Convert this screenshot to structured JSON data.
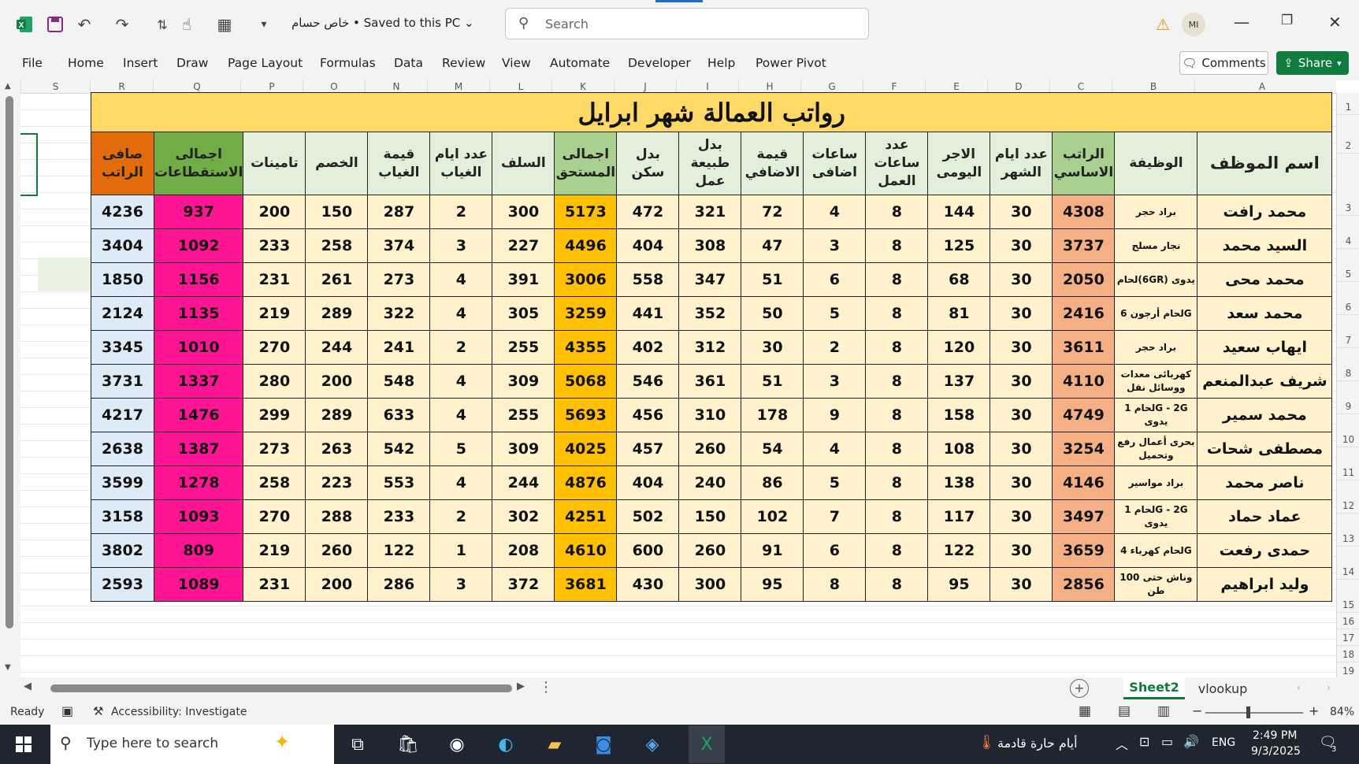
{
  "titlebar": {
    "doc_title": "خاص حسام • Saved to this PC ⌄",
    "search_placeholder": "Search",
    "avatar": "MI",
    "warning_icon": "warning-icon"
  },
  "ribbon": {
    "tabs": [
      "File",
      "Home",
      "Insert",
      "Draw",
      "Page Layout",
      "Formulas",
      "Data",
      "Review",
      "View",
      "Automate",
      "Developer",
      "Help",
      "Power Pivot"
    ],
    "comments": "Comments",
    "share": "Share"
  },
  "columns": [
    "S",
    "R",
    "Q",
    "P",
    "O",
    "N",
    "M",
    "L",
    "K",
    "J",
    "I",
    "H",
    "G",
    "F",
    "E",
    "D",
    "C",
    "B",
    "A"
  ],
  "rows": [
    "1",
    "2",
    "3",
    "4",
    "5",
    "6",
    "7",
    "8",
    "9",
    "10",
    "11",
    "12",
    "13",
    "14",
    "15",
    "16",
    "17",
    "18",
    "19"
  ],
  "sheet": {
    "title": "رواتب العمالة شهر ابرايل",
    "headers": [
      "صافى الراتب",
      "اجمالى الاستقطاعات",
      "تامينات",
      "الخصم",
      "قيمة الغياب",
      "عدد ايام الغياب",
      "السلف",
      "اجمالى المستحق",
      "بدل سكن",
      "بدل طبيعة عمل",
      "قيمة الاضافي",
      "ساعات اضافى",
      "عدد ساعات العمل",
      "الاجر اليومى",
      "عدد ايام الشهر",
      "الراتب الاساسي",
      "الوظيفة",
      "اسم الموظف"
    ],
    "rows": [
      [
        "4236",
        "937",
        "200",
        "150",
        "287",
        "2",
        "300",
        "5173",
        "472",
        "321",
        "72",
        "4",
        "8",
        "144",
        "30",
        "4308",
        "براد حجر",
        "محمد رافت"
      ],
      [
        "3404",
        "1092",
        "233",
        "258",
        "374",
        "3",
        "227",
        "4496",
        "404",
        "308",
        "47",
        "3",
        "8",
        "125",
        "30",
        "3737",
        "نجار مسلح",
        "السيد محمد"
      ],
      [
        "1850",
        "1156",
        "231",
        "261",
        "273",
        "4",
        "391",
        "3006",
        "558",
        "347",
        "51",
        "6",
        "8",
        "68",
        "30",
        "2050",
        "لحام(6GR) يدوى",
        "محمد محى"
      ],
      [
        "2124",
        "1135",
        "219",
        "289",
        "322",
        "4",
        "305",
        "3259",
        "441",
        "352",
        "50",
        "5",
        "8",
        "81",
        "30",
        "2416",
        "لحام أرجون 6G",
        "محمد سعد"
      ],
      [
        "3345",
        "1010",
        "270",
        "244",
        "241",
        "2",
        "255",
        "4355",
        "402",
        "312",
        "30",
        "2",
        "8",
        "120",
        "30",
        "3611",
        "براد حجر",
        "ايهاب سعيد"
      ],
      [
        "3731",
        "1337",
        "280",
        "200",
        "548",
        "4",
        "309",
        "5068",
        "546",
        "361",
        "51",
        "3",
        "8",
        "137",
        "30",
        "4110",
        "كهربائى معدات ووسائل نقل",
        "شريف عبدالمنعم"
      ],
      [
        "4217",
        "1476",
        "299",
        "289",
        "633",
        "4",
        "255",
        "5693",
        "456",
        "310",
        "178",
        "9",
        "8",
        "158",
        "30",
        "4749",
        "لحام 1G - 2G يدوى",
        "محمد سمير"
      ],
      [
        "2638",
        "1387",
        "273",
        "263",
        "542",
        "5",
        "309",
        "4025",
        "457",
        "260",
        "54",
        "4",
        "8",
        "108",
        "30",
        "3254",
        "بحرى أعمال رفع وتحميل",
        "مصطفى شحات"
      ],
      [
        "3599",
        "1278",
        "258",
        "223",
        "553",
        "4",
        "244",
        "4876",
        "404",
        "240",
        "86",
        "5",
        "8",
        "138",
        "30",
        "4146",
        "براد مواسير",
        "ناصر محمد"
      ],
      [
        "3158",
        "1093",
        "270",
        "288",
        "233",
        "2",
        "302",
        "4251",
        "502",
        "150",
        "102",
        "7",
        "8",
        "117",
        "30",
        "3497",
        "لحام 1G - 2G يدوى",
        "عماد حماد"
      ],
      [
        "3802",
        "809",
        "219",
        "260",
        "122",
        "1",
        "208",
        "4610",
        "600",
        "260",
        "91",
        "6",
        "8",
        "122",
        "30",
        "3659",
        "لحام كهرباء 4G",
        "حمدى رفعت"
      ],
      [
        "2593",
        "1089",
        "231",
        "200",
        "286",
        "3",
        "372",
        "3681",
        "430",
        "300",
        "95",
        "8",
        "8",
        "95",
        "30",
        "2856",
        "وناش حتى 100 طن",
        "وليد ابراهيم"
      ]
    ]
  },
  "sheet_tabs": [
    "Sheet2",
    "vlookup"
  ],
  "status": {
    "ready": "Ready",
    "accessibility": "Accessibility: Investigate",
    "zoom": "84%"
  },
  "taskbar": {
    "search_placeholder": "Type here to search",
    "weather": "أيام حارة قادمة",
    "lang": "ENG",
    "time": "2:49 PM",
    "date": "9/3/2025",
    "notifications": "3"
  },
  "colors": {
    "title_yellow": "#ffd966",
    "header_green": "#e2efda",
    "body_cream": "#fff2cc",
    "net_orange": "#e26b0a",
    "net_blue": "#ddebf7",
    "deduct_green": "#70ad47",
    "deduct_pink": "#ff1493",
    "total_green": "#a9d08e",
    "total_gold": "#ffc000",
    "basic_green": "#a9d08e",
    "basic_salmon": "#f4b084",
    "excel_green": "#0f7b3f"
  }
}
